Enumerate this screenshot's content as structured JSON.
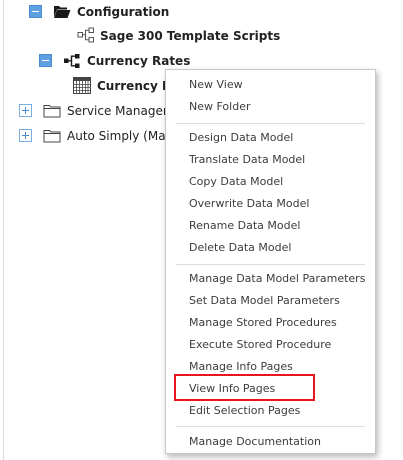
{
  "tree": {
    "configuration": {
      "label": "Configuration",
      "icon": "open-folder-icon"
    },
    "sage_scripts": {
      "label": "Sage 300 Template Scripts",
      "icon": "hierarchy-icon"
    },
    "currency_rates": {
      "label": "Currency Rates",
      "icon": "hierarchy-icon"
    },
    "currency_rates_child": {
      "label": "Currency Rat",
      "icon": "table-icon"
    },
    "service_manager": {
      "label": "Service Manager",
      "icon": "folder-icon"
    },
    "auto_simply": {
      "label": "Auto Simply (Manu",
      "icon": "folder-icon"
    }
  },
  "context_menu": {
    "items": [
      {
        "label": "New View"
      },
      {
        "label": "New Folder"
      },
      {
        "label": "Design Data Model"
      },
      {
        "label": "Translate Data Model"
      },
      {
        "label": "Copy Data Model"
      },
      {
        "label": "Overwrite Data Model"
      },
      {
        "label": "Rename Data Model"
      },
      {
        "label": "Delete Data Model"
      },
      {
        "label": "Manage Data Model Parameters"
      },
      {
        "label": "Set Data Model Parameters"
      },
      {
        "label": "Manage Stored Procedures"
      },
      {
        "label": "Execute Stored Procedure"
      },
      {
        "label": "Manage Info Pages"
      },
      {
        "label": "View Info Pages",
        "highlighted": true
      },
      {
        "label": "Edit Selection Pages"
      },
      {
        "label": "Manage Documentation"
      }
    ]
  },
  "colors": {
    "highlight": "#e8141e",
    "expander": "#5ea0e0"
  }
}
